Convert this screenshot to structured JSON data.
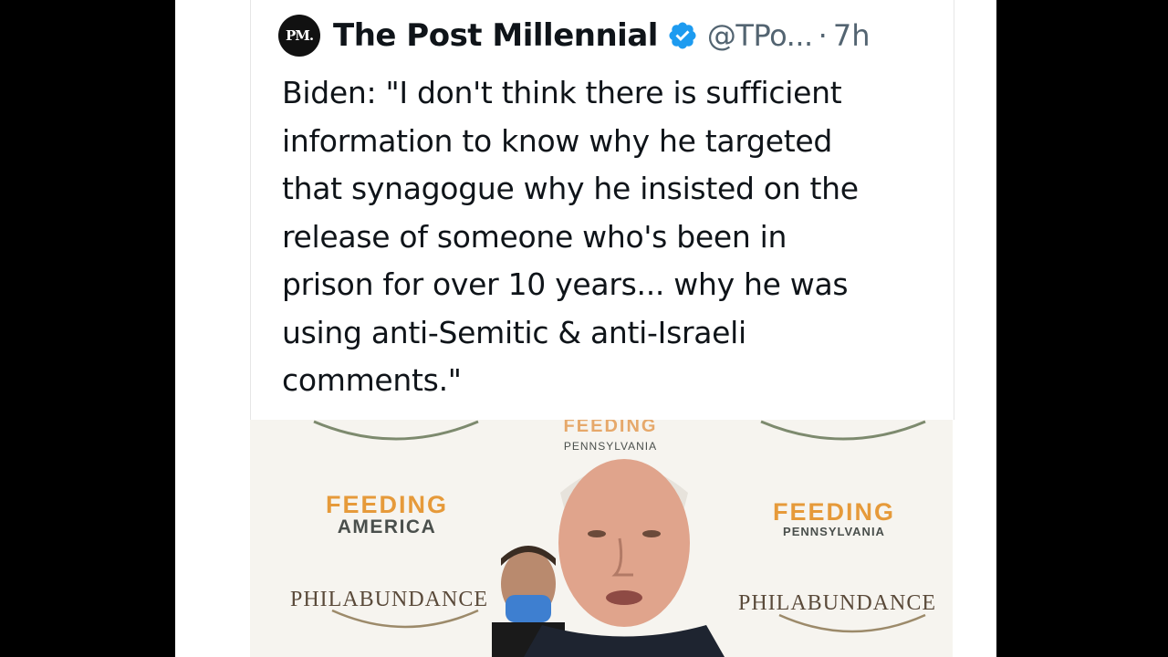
{
  "tweet": {
    "avatar_text": "PM.",
    "display_name": "The Post Millennial",
    "verified_icon": "verified-badge-icon",
    "handle": "@TPo...",
    "separator": "·",
    "timestamp": "7h",
    "lines": [
      "Biden: \"I don't think there is sufficient",
      "information to know why he targeted",
      "that synagogue why he insisted on the",
      "release of someone who's been in",
      "prison for over 10 years... why he was",
      "using anti-Semitic & anti-Israeli",
      "comments.\""
    ]
  },
  "media": {
    "backdrop_logos": {
      "feeding_america_title": "FEEDING",
      "feeding_america_sub": "AMERICA",
      "feeding_penn_title": "FEEDING",
      "feeding_penn_sub": "PENNSYLVANIA",
      "top_center_sub": "PENNSYLVANIA",
      "philabundance_left": "PHILABUNDANCE",
      "philabundance_right": "PHILABUNDANCE"
    }
  },
  "colors": {
    "verified": "#1d9bf0",
    "orange": "#e69a3a",
    "text": "#0f1419",
    "muted": "#536471"
  }
}
